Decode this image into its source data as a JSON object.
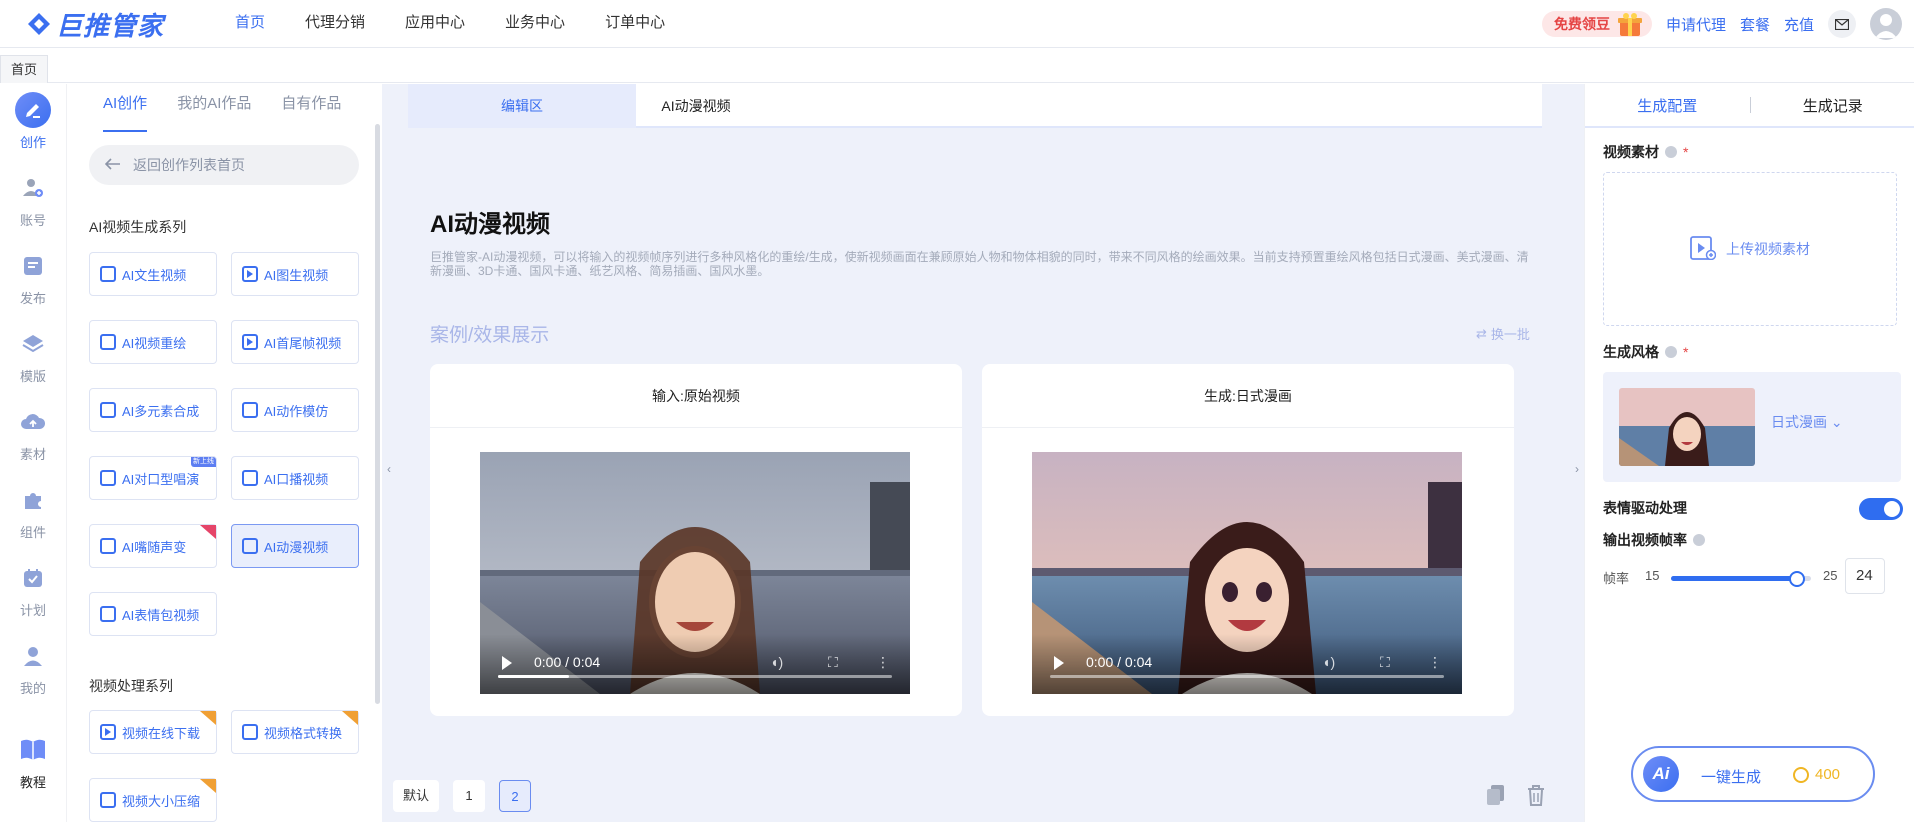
{
  "header": {
    "logo_text": "巨推管家",
    "nav": [
      "首页",
      "代理分销",
      "应用中心",
      "业务中心",
      "订单中心"
    ],
    "free_bean": "免费领豆",
    "links": [
      "申请代理",
      "套餐",
      "充值"
    ]
  },
  "tabstrip": {
    "home": "首页"
  },
  "rail": [
    {
      "label": "创作",
      "icon": "pen-icon"
    },
    {
      "label": "账号",
      "icon": "user-add-icon"
    },
    {
      "label": "发布",
      "icon": "publish-icon"
    },
    {
      "label": "模版",
      "icon": "layers-icon"
    },
    {
      "label": "素材",
      "icon": "cloud-icon"
    },
    {
      "label": "组件",
      "icon": "puzzle-icon"
    },
    {
      "label": "计划",
      "icon": "calendar-icon"
    },
    {
      "label": "我的",
      "icon": "person-icon"
    },
    {
      "label": "教程",
      "icon": "book-icon"
    }
  ],
  "sidebar": {
    "tabs": [
      "AI创作",
      "我的AI作品",
      "自有作品"
    ],
    "back_label": "返回创作列表首页",
    "series1_title": "AI视频生成系列",
    "series1_tools": [
      "AI文生视频",
      "AI图生视频",
      "AI视频重绘",
      "AI首尾帧视频",
      "AI多元素合成",
      "AI动作模仿",
      "AI对口型唱演",
      "AI口播视频",
      "AI嘴随声变",
      "AI动漫视频",
      "AI表情包视频"
    ],
    "series2_title": "视频处理系列",
    "series2_tools": [
      "视频在线下载",
      "视频格式转换",
      "视频大小压缩"
    ],
    "tag_new_label": "新上线"
  },
  "main": {
    "tabs": [
      "编辑区",
      "AI动漫视频"
    ],
    "title": "AI动漫视频",
    "description": "巨推管家-AI动漫视频，可以将输入的视频帧序列进行多种风格化的重绘/生成，使新视频画面在兼顾原始人物和物体相貌的同时，带来不同风格的绘画效果。当前支持预置重绘风格包括日式漫画、美式漫画、清新漫画、3D卡通、国风卡通、纸艺风格、简易插画、国风水墨。",
    "demo_title": "案例/效果展示",
    "swap_label": "换一批",
    "cards": [
      {
        "head": "输入:原始视频",
        "time": "0:00 / 0:04",
        "progress": 0.18
      },
      {
        "head": "生成:日式漫画",
        "time": "0:00 / 0:04",
        "progress": 0.0
      }
    ],
    "pager": [
      "默认",
      "1",
      "2"
    ]
  },
  "right": {
    "tabs": [
      "生成配置",
      "生成记录"
    ],
    "video_label": "视频素材",
    "upload_label": "上传视频素材",
    "style_label": "生成风格",
    "style_value": "日式漫画",
    "expression_label": "表情驱动处理",
    "expression_on": true,
    "fps_label": "输出视频帧率",
    "fps_prefix": "帧率",
    "fps_min": "15",
    "fps_max": "25",
    "fps_value": "24",
    "generate_label": "一键生成",
    "cost": "400",
    "ai_badge": "Ai"
  },
  "colors": {
    "accent": "#3b6ff0",
    "danger": "#e54545",
    "coin": "#f0b624"
  }
}
